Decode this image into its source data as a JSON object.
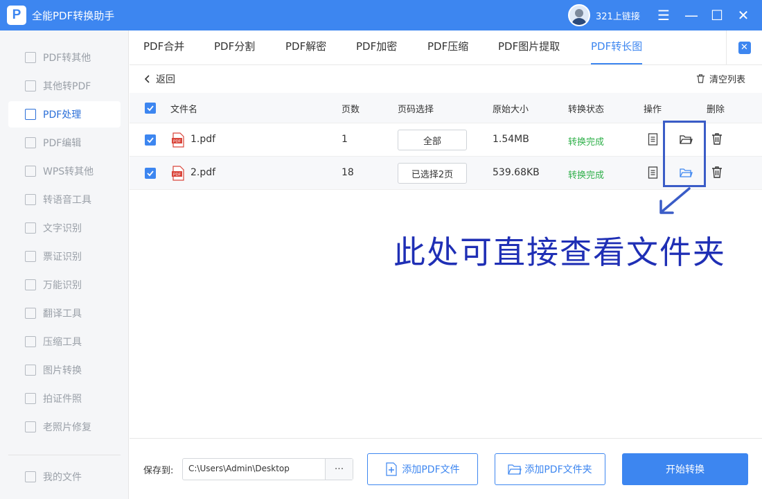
{
  "app": {
    "title": "全能PDF转换助手",
    "logo_letter": "P",
    "user_name": "321上链接"
  },
  "window_controls": {
    "menu": "☰",
    "minimize": "—",
    "maximize": "☐",
    "close": "✕"
  },
  "sidebar": {
    "items": [
      {
        "label": "PDF转其他",
        "active": false
      },
      {
        "label": "其他转PDF",
        "active": false
      },
      {
        "label": "PDF处理",
        "active": true
      },
      {
        "label": "PDF编辑",
        "active": false
      },
      {
        "label": "WPS转其他",
        "active": false
      },
      {
        "label": "转语音工具",
        "active": false
      },
      {
        "label": "文字识别",
        "active": false
      },
      {
        "label": "票证识别",
        "active": false
      },
      {
        "label": "万能识别",
        "active": false
      },
      {
        "label": "翻译工具",
        "active": false
      },
      {
        "label": "压缩工具",
        "active": false
      },
      {
        "label": "图片转换",
        "active": false
      },
      {
        "label": "拍证件照",
        "active": false
      },
      {
        "label": "老照片修复",
        "active": false
      }
    ],
    "my_files": "我的文件"
  },
  "tabs": [
    {
      "label": "PDF合并",
      "active": false
    },
    {
      "label": "PDF分割",
      "active": false
    },
    {
      "label": "PDF解密",
      "active": false
    },
    {
      "label": "PDF加密",
      "active": false
    },
    {
      "label": "PDF压缩",
      "active": false
    },
    {
      "label": "PDF图片提取",
      "active": false
    },
    {
      "label": "PDF转长图",
      "active": true
    }
  ],
  "toolbar": {
    "back": "返回",
    "clear": "清空列表"
  },
  "table": {
    "headers": {
      "name": "文件名",
      "pages": "页数",
      "page_select": "页码选择",
      "size": "原始大小",
      "status": "转换状态",
      "actions": "操作",
      "delete": "删除"
    },
    "rows": [
      {
        "name": "1.pdf",
        "pages": "1",
        "page_select": "全部",
        "size": "1.54MB",
        "status": "转换完成",
        "checked": true
      },
      {
        "name": "2.pdf",
        "pages": "18",
        "page_select": "已选择2页",
        "size": "539.68KB",
        "status": "转换完成",
        "checked": true
      }
    ]
  },
  "annotation": "此处可直接查看文件夹",
  "footer": {
    "save_label": "保存到:",
    "save_path": "C:\\Users\\Admin\\Desktop",
    "more": "···",
    "add_file": "添加PDF文件",
    "add_folder": "添加PDF文件夹",
    "start": "开始转换"
  },
  "colors": {
    "accent": "#3d86f0",
    "success": "#2fb04a",
    "annotation": "#1f2fb5"
  }
}
